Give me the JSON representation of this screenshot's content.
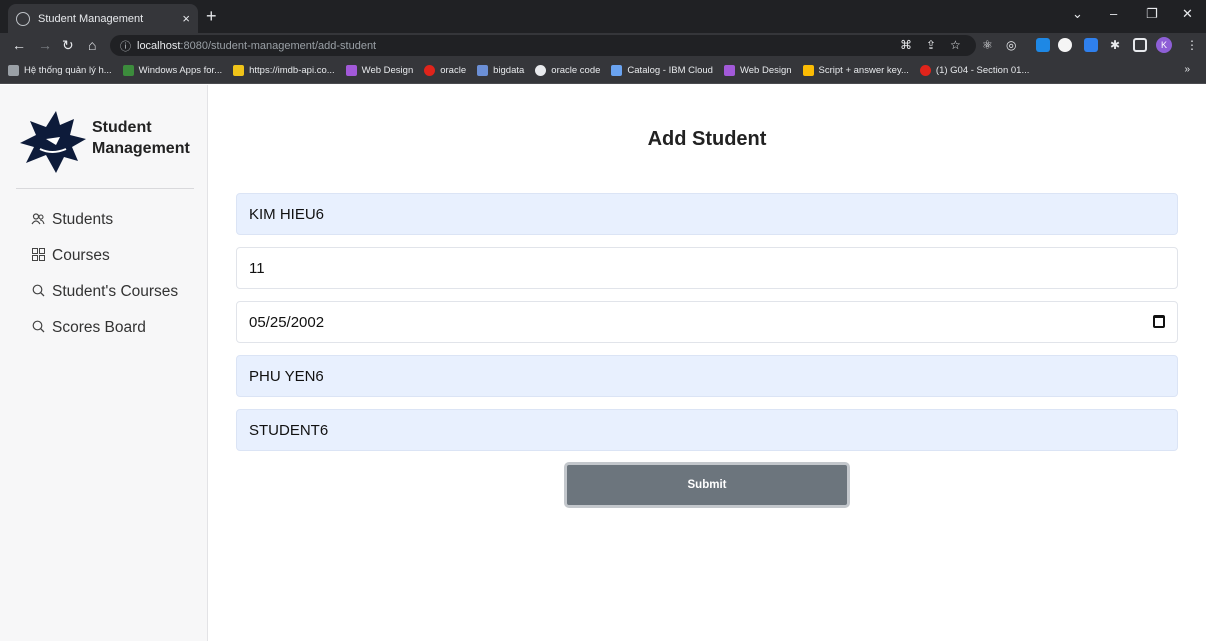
{
  "browser": {
    "tab_title": "Student Management",
    "tab_close": "×",
    "new_tab": "+",
    "url_host": "localhost",
    "url_path": ":8080/student-management/add-student",
    "profile_initial": "K",
    "bookmarks": [
      {
        "label": "Hệ thống quản lý h...",
        "color": "#9aa0a6"
      },
      {
        "label": "Windows Apps for...",
        "color": "#3c8c3c"
      },
      {
        "label": "https://imdb-api.co...",
        "color": "#f0c419"
      },
      {
        "label": "Web Design",
        "color": "#a259d9"
      },
      {
        "label": "oracle",
        "color": "#e0241b"
      },
      {
        "label": "bigdata",
        "color": "#6b8fd6"
      },
      {
        "label": "oracle code",
        "color": "#e8eaed"
      },
      {
        "label": "Catalog - IBM Cloud",
        "color": "#6aa3f0"
      },
      {
        "label": "Web Design",
        "color": "#a259d9"
      },
      {
        "label": "Script + answer key...",
        "color": "#fbbc04"
      },
      {
        "label": "(1) G04 - Section 01...",
        "color": "#e0241b"
      }
    ],
    "bookmarks_more": "»"
  },
  "sidebar": {
    "brand_line1": "Student",
    "brand_line2": "Management",
    "items": [
      {
        "label": "Students",
        "icon": "users-icon"
      },
      {
        "label": "Courses",
        "icon": "grid-icon"
      },
      {
        "label": "Student's Courses",
        "icon": "search-icon"
      },
      {
        "label": "Scores Board",
        "icon": "search-icon"
      }
    ]
  },
  "form": {
    "title": "Add Student",
    "name": "KIM HIEU6",
    "age": "11",
    "birthday": "05/25/2002",
    "address": "PHU YEN6",
    "type": "STUDENT6",
    "submit_label": "Submit"
  }
}
